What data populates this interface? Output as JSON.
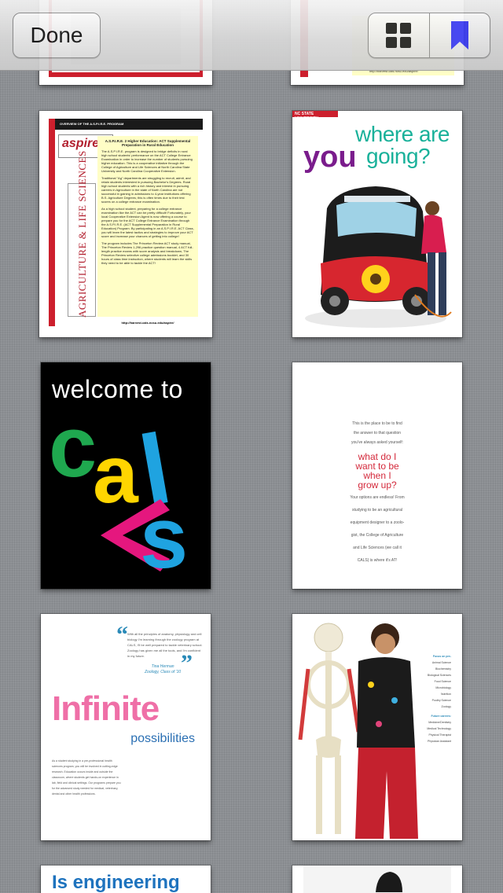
{
  "toolbar": {
    "done_label": "Done",
    "grid_icon": "grid-icon",
    "bookmark_icon": "bookmark-icon",
    "bookmark_color": "#3b3cf0"
  },
  "pages": {
    "aspire": {
      "header": "OVERVIEW OF THE A.S.P.I.R.E. PROGRAM",
      "logo": "aspire2",
      "heading": "A.S.P.I.R.E. 2 Higher Education: ACT Supplemental Preparation in Rural Education",
      "para1": "The A.S.P.I.R.E. program is designed to bridge deficits in rural high school students' performance on the ACT College Entrance Examination in order to increase the number of students pursuing higher education. This is a cooperative initiative through the College of Agriculture and Life Sciences at North Carolina State University and North Carolina Cooperative Extension.",
      "para2": "Traditional \"Ag\" departments are struggling to recruit, admit, and retain students interested in pursuing Bachelor's Degrees. Rural high school students with a rich history and interest in pursuing careers in Agriculture in the state of North Carolina are not successful in gaining in admissions to 4-year institutions offering B.S. Agriculture Degrees; this is often times due to their test scores on a college entrance examination.",
      "para3": "As a high school student, preparing for a college entrance examination like the ACT can be pretty difficult! Fortunately, your local Cooperative Extension Agent is now offering a course to prepare you for the ACT College Entrance Examination through the A.S.P.I.R.E. (ACT Supplemental Preparation in Rural Education) Program. By participating in an A.S.P.I.R.E. ACT Class, you will learn the latest tactics and strategies to improve your ACT score and increase your chances of getting into college!",
      "para4": "The program includes The Princeton Review ACT study manual, The Princeton Review 1,296 practice question manual, 4 ACT full-length practice exams with score analysis and breakdown, The Princeton Review selective college admissions booklet, and 30 hours of class time instruction, where students will learn the skills they need to be able to tackle the ACT!",
      "vertical": "AGRICULTURE & LIFE SCIENCES",
      "url": "http://harvest.cals.ncsu.edu/aspire/"
    },
    "where": {
      "tag": "NC STATE UNIVERSITY",
      "line1": "where are",
      "you": "you",
      "going": "going?"
    },
    "cals": {
      "welcome": "welcome to",
      "letters": [
        "c",
        "a",
        "l",
        "s"
      ],
      "colors": [
        "#1fa84f",
        "#ffd500",
        "#e5177e",
        "#1fa3e0"
      ]
    },
    "question": {
      "pre": [
        "This is the place to be to find",
        "the answer to that question",
        "you've always asked yourself:"
      ],
      "q": [
        "what do I",
        "want to be",
        "when I",
        "grow up?"
      ],
      "post": [
        "Your options are endless! From",
        "studying to be an agricultural",
        "equipment designer to a zoolo-",
        "gist, the College of Agriculture",
        "and Life Sciences (we call it",
        "CALS) is where it's AT!"
      ]
    },
    "infinite": {
      "quote": "With all the principles of anatomy, physiology and cell biology I'm learning through the zoology program at CALS, I'll be well prepared to tackle veterinary school. Zoology has given me all the tools, and I'm confident in my future.",
      "author_name": "Tina Herman",
      "author_class": "Zoology, Class of '10",
      "title": "Infinite",
      "subtitle": "possibilities",
      "body": "As a student studying in a pre-professional health sciences program, you will be involved in cutting-edge research. Education occurs inside and outside the classroom, where students get hands-on experience in lab, field and clinical settings. Our programs prepare you for the advanced study needed for medical, veterinary, dental and other health professions."
    },
    "skeleton": {
      "h1": "Focus on pre-",
      "items1": [
        "Animal Science",
        "Biochemistry",
        "Biological Sciences",
        "Food Science",
        "Microbiology",
        "Nutrition",
        "Poultry Science",
        "Zoology"
      ],
      "h2": "Future careers:",
      "items2": [
        "Medicine/Dentistry",
        "Medical Technology",
        "Physical Therapist",
        "Physician Assistant"
      ]
    },
    "engineering": {
      "title": "Is engineering"
    }
  }
}
